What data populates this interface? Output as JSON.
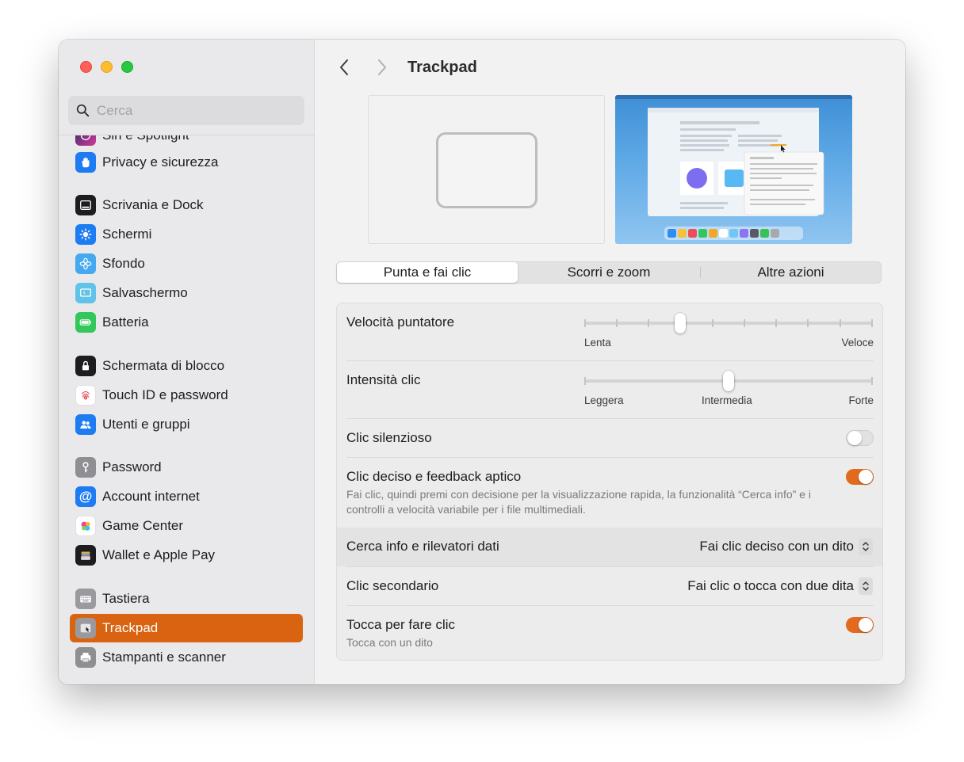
{
  "window": {
    "title": "Trackpad"
  },
  "search": {
    "placeholder": "Cerca"
  },
  "sidebar": {
    "items": [
      {
        "label": "Siri e Spotlight",
        "icon": "siri-icon",
        "color": "#6a5cff"
      },
      {
        "label": "Privacy e sicurezza",
        "icon": "hand-icon",
        "color": "#1e7cf2"
      },
      {
        "label": "Scrivania e Dock",
        "icon": "dock-icon",
        "color": "#1d1d1f"
      },
      {
        "label": "Schermi",
        "icon": "sun-icon",
        "color": "#1e7cf2"
      },
      {
        "label": "Sfondo",
        "icon": "flower-icon",
        "color": "#45a8f0"
      },
      {
        "label": "Salvaschermo",
        "icon": "screensaver-icon",
        "color": "#62c3e8"
      },
      {
        "label": "Batteria",
        "icon": "battery-icon",
        "color": "#34c759"
      },
      {
        "label": "Schermata di blocco",
        "icon": "lock-icon",
        "color": "#1d1d1f"
      },
      {
        "label": "Touch ID e password",
        "icon": "fingerprint-icon",
        "color": "#ffffff"
      },
      {
        "label": "Utenti e gruppi",
        "icon": "users-icon",
        "color": "#1e7cf2"
      },
      {
        "label": "Password",
        "icon": "key-icon",
        "color": "#8e8e93"
      },
      {
        "label": "Account internet",
        "icon": "at-icon",
        "color": "#1e7cf2"
      },
      {
        "label": "Game Center",
        "icon": "game-center-icon",
        "color": "#ffffff"
      },
      {
        "label": "Wallet e Apple Pay",
        "icon": "wallet-icon",
        "color": "#1d1d1f"
      },
      {
        "label": "Tastiera",
        "icon": "keyboard-icon",
        "color": "#9a9a9e"
      },
      {
        "label": "Trackpad",
        "icon": "trackpad-icon",
        "color": "#9a9a9e"
      },
      {
        "label": "Stampanti e scanner",
        "icon": "printer-icon",
        "color": "#8e8e93"
      }
    ]
  },
  "tabs": [
    {
      "label": "Punta e fai clic",
      "active": true
    },
    {
      "label": "Scorri e zoom",
      "active": false
    },
    {
      "label": "Altre azioni",
      "active": false
    }
  ],
  "settings": {
    "pointer_speed": {
      "label": "Velocità puntatore",
      "min_label": "Lenta",
      "max_label": "Veloce",
      "level": 0.33
    },
    "click_intensity": {
      "label": "Intensità clic",
      "min_label": "Leggera",
      "mid_label": "Intermedia",
      "max_label": "Forte",
      "level": 0.5
    },
    "silent_click": {
      "label": "Clic silenzioso",
      "on": false
    },
    "force_click": {
      "label": "Clic deciso e feedback aptico",
      "description": "Fai clic, quindi premi con decisione per la visualizzazione rapida, la funzionalità “Cerca info” e i controlli a velocità variabile per i file multimediali.",
      "on": true
    },
    "lookup": {
      "label": "Cerca info e rilevatori dati",
      "value": "Fai clic deciso con un dito"
    },
    "secondary_click": {
      "label": "Clic secondario",
      "value": "Fai clic o tocca con due dita"
    },
    "tap_to_click": {
      "label": "Tocca per fare clic",
      "sub": "Tocca con un dito",
      "on": true
    }
  },
  "colors": {
    "accent": "#d96311",
    "toggle_on": "#e16a1e"
  }
}
